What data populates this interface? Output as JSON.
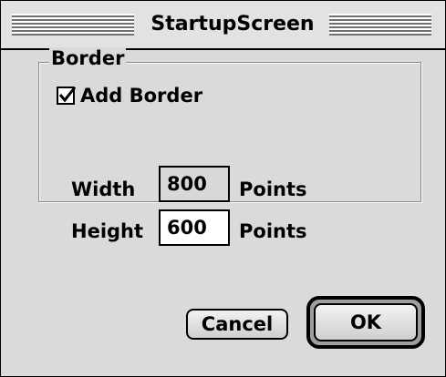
{
  "window": {
    "title": "StartupScreen"
  },
  "border_group": {
    "label": "Border",
    "add_border": {
      "label": "Add Border",
      "checked": true
    },
    "width": {
      "label": "Width",
      "value": "800",
      "unit": "Points"
    },
    "height": {
      "label": "Height",
      "value": "600",
      "unit": "Points"
    }
  },
  "buttons": {
    "cancel_label": "Cancel",
    "ok_label": "OK"
  },
  "icons": {
    "checkbox": "checkmark-icon"
  }
}
